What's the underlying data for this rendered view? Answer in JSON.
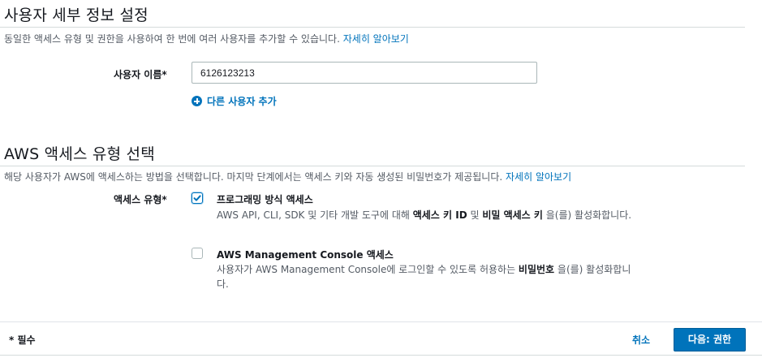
{
  "user_details": {
    "title": "사용자 세부 정보 설정",
    "description": "동일한 액세스 유형 및 권한을 사용하여 한 번에 여러 사용자를 추가할 수 있습니다.",
    "learn_more": "자세히 알아보기",
    "username_label": "사용자 이름*",
    "username_value": "6126123213",
    "add_user_label": "다른 사용자 추가"
  },
  "access_type": {
    "title": "AWS 액세스 유형 선택",
    "description": "해당 사용자가 AWS에 액세스하는 방법을 선택합니다. 마지막 단계에서는 액세스 키와 자동 생성된 비밀번호가 제공됩니다.",
    "learn_more": "자세히 알아보기",
    "field_label": "액세스 유형*",
    "options": [
      {
        "title": "프로그래밍 방식 액세스",
        "desc_before": "AWS API, CLI, SDK 및 기타 개발 도구에 대해 ",
        "desc_bold1": "액세스 키 ID",
        "desc_mid": " 및 ",
        "desc_bold2": "비밀 액세스 키",
        "desc_after": " 을(를) 활성화합니다.",
        "checked": true
      },
      {
        "title": "AWS Management Console 액세스",
        "desc_before": "사용자가 AWS Management Console에 로그인할 수 있도록 허용하는 ",
        "desc_bold1": "비밀번호",
        "desc_after": " 을(를) 활성화합니다.",
        "checked": false
      }
    ]
  },
  "footer": {
    "required_note": "* 필수",
    "cancel_label": "취소",
    "next_label": "다음: 권한"
  },
  "colors": {
    "link": "#0073bb",
    "primary_button": "#0073bb",
    "text": "#16191f",
    "muted_text": "#545b64"
  }
}
